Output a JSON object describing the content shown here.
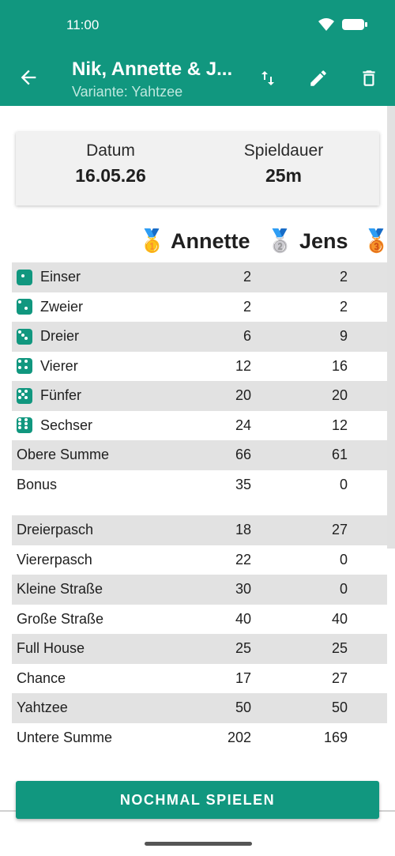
{
  "status": {
    "time": "11:00"
  },
  "header": {
    "title": "Nik, Annette & J...",
    "subtitle": "Variante: Yahtzee",
    "icons": [
      "arrow-left-icon",
      "swap-vert-icon",
      "pencil-icon",
      "trash-icon"
    ]
  },
  "info": {
    "date_label": "Datum",
    "date_value": "16.05.26",
    "duration_label": "Spieldauer",
    "duration_value": "25m"
  },
  "players": [
    {
      "medal": "🥇",
      "name": "Annette"
    },
    {
      "medal": "🥈",
      "name": "Jens"
    },
    {
      "medal": "🥉",
      "name": ""
    }
  ],
  "rows": [
    {
      "label": "Einser",
      "a": "2",
      "b": "2",
      "die": 1
    },
    {
      "label": "Zweier",
      "a": "2",
      "b": "2",
      "die": 2
    },
    {
      "label": "Dreier",
      "a": "6",
      "b": "9",
      "die": 3
    },
    {
      "label": "Vierer",
      "a": "12",
      "b": "16",
      "die": 4
    },
    {
      "label": "Fünfer",
      "a": "20",
      "b": "20",
      "die": 5
    },
    {
      "label": "Sechser",
      "a": "24",
      "b": "12",
      "die": 6
    },
    {
      "label": "Obere Summe",
      "a": "66",
      "b": "61"
    },
    {
      "label": "Bonus",
      "a": "35",
      "b": "0"
    },
    {
      "label": "Dreierpasch",
      "a": "18",
      "b": "27"
    },
    {
      "label": "Viererpasch",
      "a": "22",
      "b": "0"
    },
    {
      "label": "Kleine Straße",
      "a": "30",
      "b": "0"
    },
    {
      "label": "Große Straße",
      "a": "40",
      "b": "40"
    },
    {
      "label": "Full House",
      "a": "25",
      "b": "25"
    },
    {
      "label": "Chance",
      "a": "17",
      "b": "27"
    },
    {
      "label": "Yahtzee",
      "a": "50",
      "b": "50"
    },
    {
      "label": "Untere Summe",
      "a": "202",
      "b": "169"
    }
  ],
  "button": {
    "label": "NOCHMAL SPIELEN"
  },
  "colors": {
    "primary": "#11977f",
    "row_shade": "#e2e2e2"
  }
}
